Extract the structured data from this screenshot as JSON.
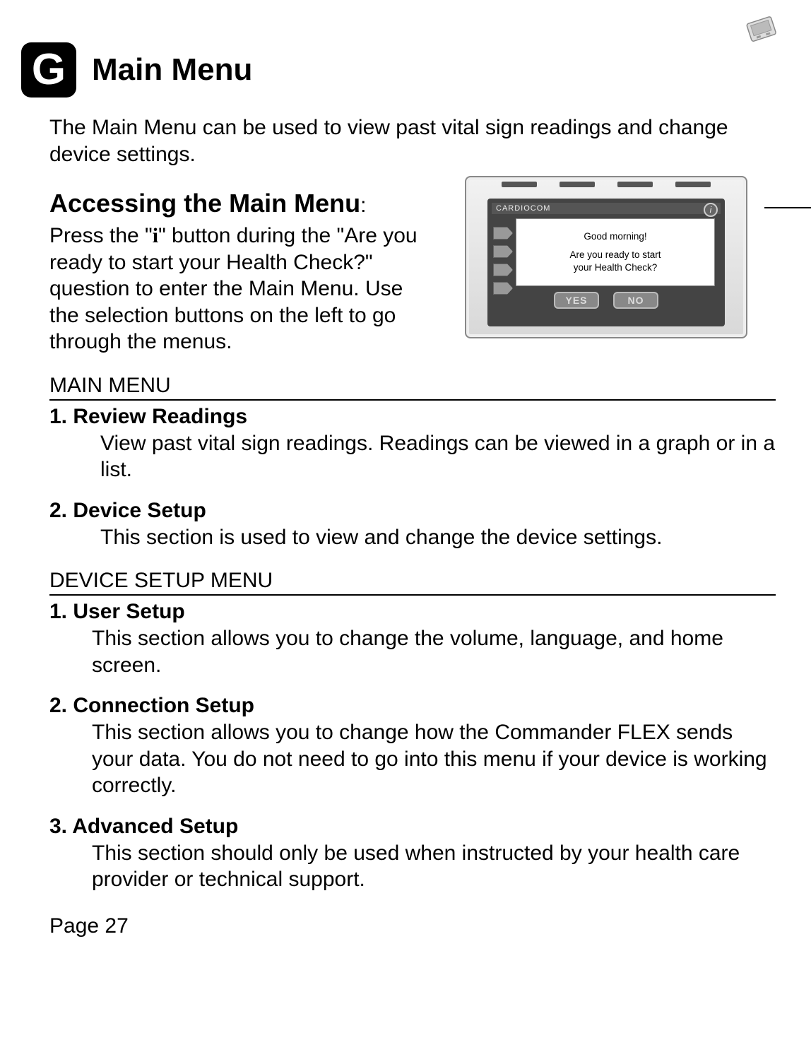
{
  "section": {
    "letter": "G",
    "title": "Main Menu",
    "intro": "The Main Menu can be used to view past vital sign readings and change device settings."
  },
  "accessing": {
    "heading": "Accessing the Main Menu",
    "colon": ":",
    "text_pre": "Press the \"",
    "i_char": "i",
    "text_post": "\" button during the \"Are you ready to start your Health Check?\" question to enter the Main Menu.   Use the selection buttons on the left to go through the menus."
  },
  "device": {
    "brand": "CARDIOCOM",
    "screen_line1": "Good morning!",
    "screen_line2": "Are you ready to start",
    "screen_line3": "your Health Check?",
    "yes": "YES",
    "no": "NO"
  },
  "main_menu": {
    "heading": "MAIN MENU",
    "items": [
      {
        "title": "1.   Review Readings",
        "desc": "View past vital sign readings.  Readings can be viewed in a graph or in a list."
      },
      {
        "title": "2.   Device Setup",
        "desc": "This section is used to view and change the device settings."
      }
    ]
  },
  "device_setup": {
    "heading": "DEVICE SETUP MENU",
    "items": [
      {
        "title": "1. User Setup",
        "desc": "This section allows you to change the volume, language, and home screen."
      },
      {
        "title": "2. Connection Setup",
        "desc": "This section allows you to change how the Commander FLEX sends your data.  You do not need to go into this menu if your device is working correctly."
      },
      {
        "title": "3. Advanced Setup",
        "desc": "This section should only be used when instructed by your health care provider or technical support."
      }
    ]
  },
  "page_number": "Page 27"
}
